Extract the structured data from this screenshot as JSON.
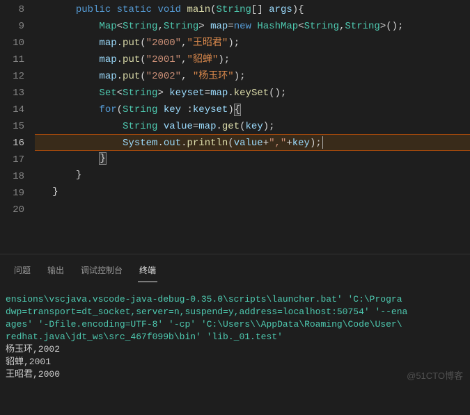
{
  "gutter": {
    "lines": [
      "8",
      "9",
      "10",
      "11",
      "12",
      "13",
      "14",
      "15",
      "16",
      "17",
      "18",
      "19",
      "20"
    ],
    "current_index": 8
  },
  "code": {
    "l8": {
      "kw1": "public",
      "kw2": "static",
      "kw3": "void",
      "fn": "main",
      "type": "String",
      "var": "args"
    },
    "l9": {
      "type1": "Map",
      "type2": "String",
      "type3": "String",
      "var": "map",
      "kw": "new",
      "type4": "HashMap",
      "type5": "String",
      "type6": "String"
    },
    "l10": {
      "var": "map",
      "fn": "put",
      "s1": "\"2000\"",
      "s2": "\"王昭君\""
    },
    "l11": {
      "var": "map",
      "fn": "put",
      "s1": "\"2001\"",
      "s2": "\"貂蝉\""
    },
    "l12": {
      "var": "map",
      "fn": "put",
      "s1": "\"2002\"",
      "s2": "\"杨玉环\""
    },
    "l13": {
      "type1": "Set",
      "type2": "String",
      "var1": "keyset",
      "var2": "map",
      "fn": "keySet"
    },
    "l14": {
      "kw": "for",
      "type": "String",
      "var1": "key",
      "var2": "keyset"
    },
    "l15": {
      "type": "String",
      "var1": "value",
      "var2": "map",
      "fn": "get",
      "arg": "key"
    },
    "l16": {
      "var1": "System",
      "var2": "out",
      "fn": "println",
      "arg1": "value",
      "s": "\",\"",
      "arg2": "key"
    }
  },
  "tabs": {
    "t1": "问题",
    "t2": "输出",
    "t3": "调试控制台",
    "t4": "终端"
  },
  "terminal": {
    "cmd1": "ensions\\vscjava.vscode-java-debug-0.35.0\\scripts\\launcher.bat' 'C:\\Progra",
    "cmd2": "dwp=transport=dt_socket,server=n,suspend=y,address=localhost:50754' '--ena",
    "cmd3": "ages' '-Dfile.encoding=UTF-8' '-cp' 'C:\\Users\\\\AppData\\Roaming\\Code\\User\\",
    "cmd4": "redhat.java\\jdt_ws\\src_467f099b\\bin' 'lib._01.test'",
    "out1": "杨玉环,2002",
    "out2": "貂蝉,2001",
    "out3": "王昭君,2000"
  },
  "watermark": "@51CTO博客"
}
